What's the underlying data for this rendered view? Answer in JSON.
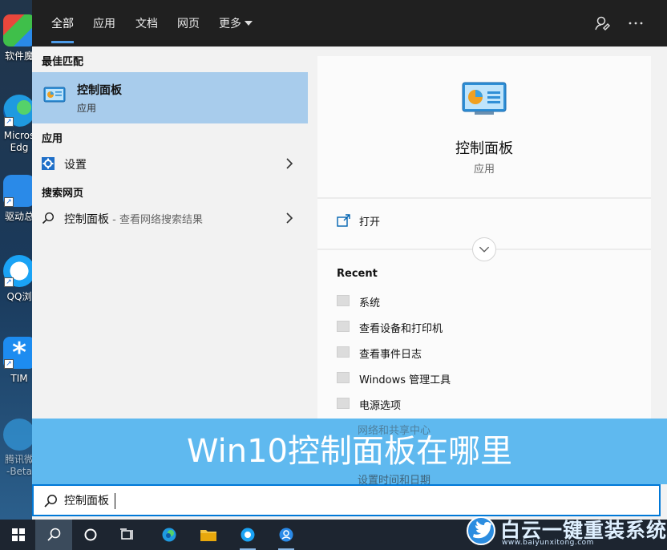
{
  "desktop": {
    "icons": [
      {
        "label": "软件魔",
        "color": "#e8473c"
      },
      {
        "label": "Micros\nEdg",
        "color": "#1f9ae0"
      },
      {
        "label": "驱动总",
        "color": "#2a8ae8"
      },
      {
        "label": "QQ浏",
        "color": "#1aa3f5"
      },
      {
        "label": "TIM",
        "color": "#1d8cf0"
      },
      {
        "label": "腾讯微\n-Beta",
        "color": "#36a7f0"
      }
    ]
  },
  "tabs": {
    "all": "全部",
    "apps": "应用",
    "documents": "文档",
    "web": "网页",
    "more": "更多"
  },
  "left": {
    "best_match_heading": "最佳匹配",
    "best_match": {
      "title": "控制面板",
      "subtitle": "应用"
    },
    "apps_heading": "应用",
    "settings_label": "设置",
    "web_heading": "搜索网页",
    "web_result": {
      "query": "控制面板",
      "suffix": " - 查看网络搜索结果"
    }
  },
  "right": {
    "title": "控制面板",
    "subtitle": "应用",
    "open_label": "打开",
    "recent_heading": "Recent",
    "recent_items": [
      "系统",
      "查看设备和打印机",
      "查看事件日志",
      "Windows 管理工具",
      "电源选项",
      "网络和共享中心",
      "设置时间和日期"
    ]
  },
  "banner": {
    "text": "Win10控制面板在哪里"
  },
  "search": {
    "value": "控制面板"
  },
  "watermark": {
    "title": "白云一键重装系统",
    "url": "www.baiyunxitong.com"
  },
  "colors": {
    "accent": "#0078d7",
    "selected": "#a8ccec",
    "banner": "#4ab0ee"
  }
}
